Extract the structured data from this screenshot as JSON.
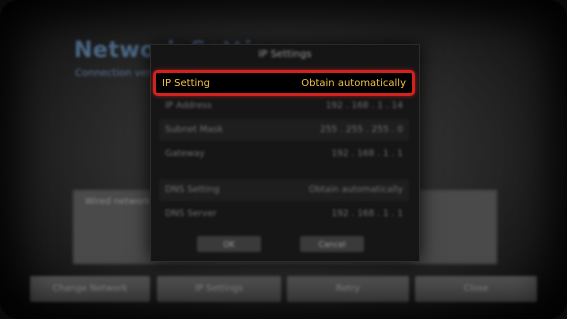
{
  "background": {
    "title": "Network Settings",
    "subtitle": "Connection ver",
    "panel_text": "Wired network c",
    "buttons": [
      "Change Network",
      "IP Settings",
      "Retry",
      "Close"
    ]
  },
  "dialog": {
    "title": "IP Settings",
    "ip_setting": {
      "label": "IP Setting",
      "value": "Obtain automatically"
    },
    "ip_address": {
      "label": "IP Address",
      "value": "192 . 168 . 1 . 14"
    },
    "subnet_mask": {
      "label": "Subnet Mask",
      "value": "255 . 255 . 255 . 0"
    },
    "gateway": {
      "label": "Gateway",
      "value": "192 . 168 . 1 . 1"
    },
    "dns_setting": {
      "label": "DNS Setting",
      "value": "Obtain automatically"
    },
    "dns_server": {
      "label": "DNS Server",
      "value": "192 . 168 . 1 . 1"
    },
    "ok_label": "OK",
    "cancel_label": "Cancel"
  },
  "colors": {
    "selection_border": "#d3221e",
    "selection_text": "#f2c24a"
  }
}
